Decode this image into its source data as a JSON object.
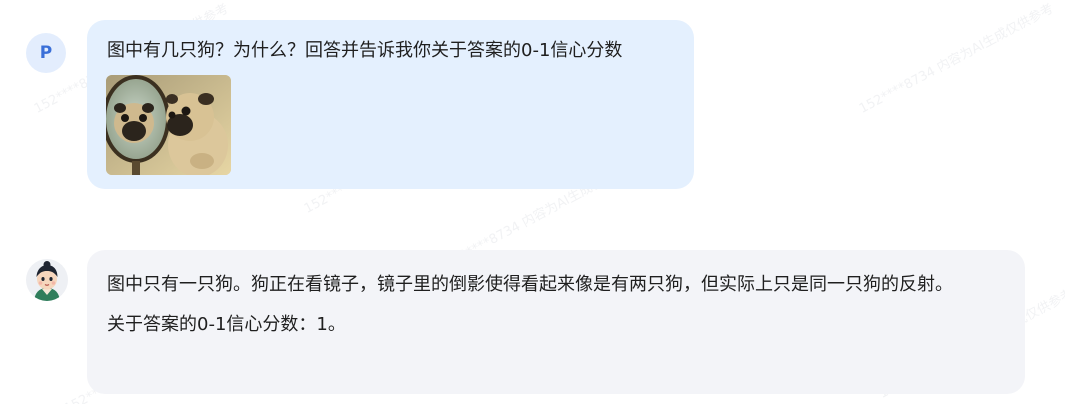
{
  "watermark": {
    "text": "152****8734 内容为AI生成仅供参考"
  },
  "user_message": {
    "avatar_letter": "P",
    "text": "图中有几只狗？为什么？回答并告诉我你关于答案的0-1信心分数",
    "image_icon": "pug-mirror-photo"
  },
  "assistant_message": {
    "avatar_icon": "cartoon-character-avatar",
    "paragraphs": [
      "图中只有一只狗。狗正在看镜子，镜子里的倒影使得看起来像是有两只狗，但实际上只是同一只狗的反射。",
      "关于答案的0-1信心分数：1。"
    ]
  },
  "colors": {
    "user_bubble": "#e4f0fe",
    "assistant_bubble": "#f3f4f8",
    "user_avatar_bg": "#e3edfd",
    "user_avatar_text": "#3a6fd8"
  }
}
